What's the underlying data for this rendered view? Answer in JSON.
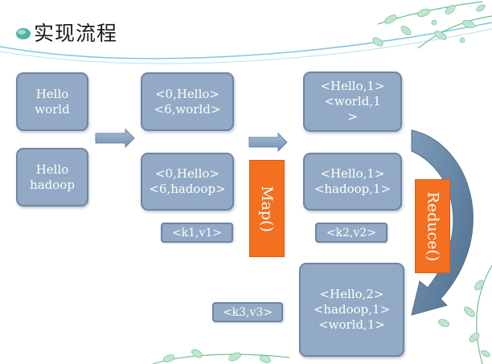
{
  "title": "实现流程",
  "colors": {
    "box_fill": "#92aac5",
    "box_border": "#6d86a3",
    "function_fill": "#f37021",
    "arrow_fill": "#8ba6c6",
    "curve_arrow": "#5f7f9f",
    "accent": "#4fb3a6"
  },
  "inputs": {
    "split1": "Hello\nworld",
    "split2": "Hello\nhadoop"
  },
  "map_stage": {
    "box1": "<0,Hello>\n<6,world>",
    "box2": "<0,Hello>\n<6,hadoop>",
    "label": "<k1,v1>"
  },
  "map_function": "Map()",
  "map_output": {
    "box1": "<Hello,1>\n<world,1\n>",
    "box2": "<Hello,1>\n<hadoop,1>",
    "label": "<k2,v2>"
  },
  "reduce_function": "Reduce()",
  "reduce_output": {
    "box": "<Hello,2>\n<hadoop,1>\n<world,1>",
    "label": "<k3,v3>"
  },
  "icons": {
    "title_bullet": "leaf-bullet-icon",
    "decoration": "vine-leaves-icon"
  }
}
